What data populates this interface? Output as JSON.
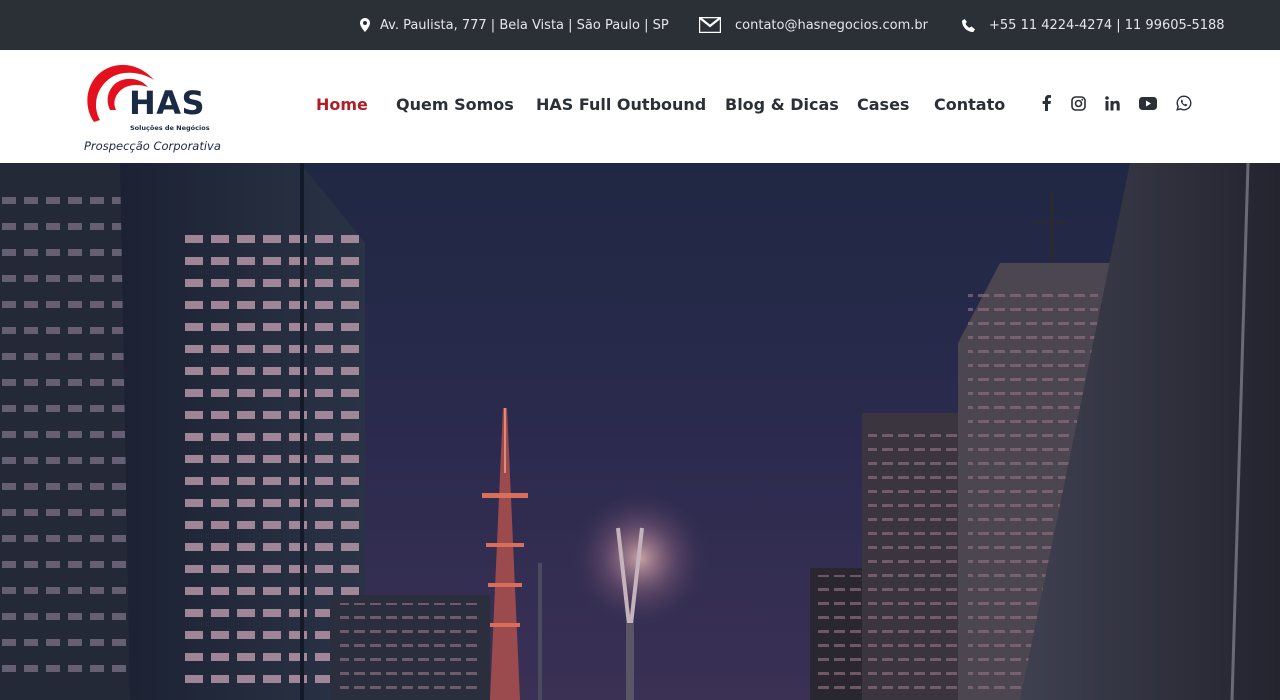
{
  "topbar": {
    "address": "Av. Paulista, 777 | Bela Vista | São Paulo | SP",
    "email": "contato@hasnegocios.com.br",
    "phone": "+55 11 4224-4274 | 11 99605-5188",
    "icons": [
      "map-pin-icon",
      "envelope-icon",
      "phone-icon"
    ]
  },
  "logo": {
    "name": "HAS",
    "tagline": "Soluções de Negócios",
    "subtitle": "Prospecção Corporativa"
  },
  "nav": {
    "items": [
      {
        "label": "Home",
        "active": true
      },
      {
        "label": "Quem Somos",
        "active": false
      },
      {
        "label": "HAS Full Outbound",
        "active": false
      },
      {
        "label": "Blog & Dicas",
        "active": false
      },
      {
        "label": "Cases",
        "active": false
      },
      {
        "label": "Contato",
        "active": false
      }
    ]
  },
  "social": [
    "facebook-icon",
    "instagram-icon",
    "linkedin-icon",
    "youtube-icon",
    "whatsapp-icon"
  ],
  "colors": {
    "accent": "#b01e2a",
    "topbar_bg": "#2b3036",
    "text_dark": "#2b3036",
    "brand_navy": "#1a2a45",
    "brand_red": "#e3111d"
  }
}
